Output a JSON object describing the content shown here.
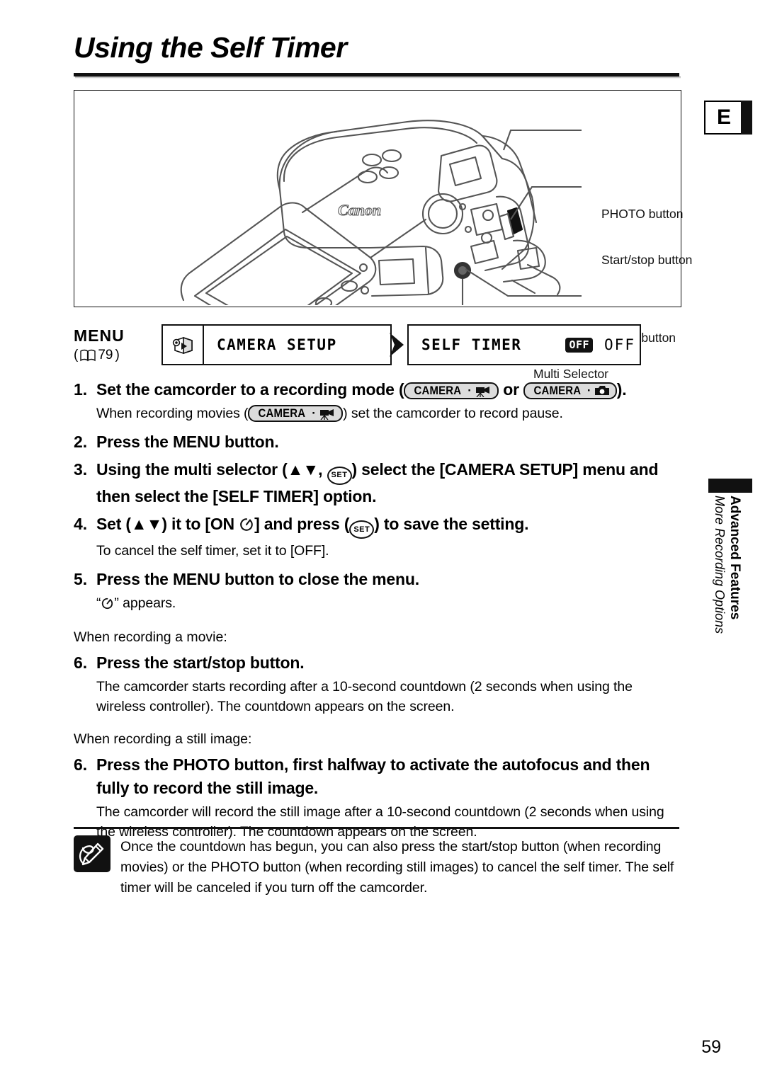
{
  "page": {
    "title": "Using the Self Timer",
    "edition_tab": "E",
    "page_number": "59"
  },
  "figure": {
    "callouts": [
      {
        "id": "photo-button",
        "label": "PHOTO button"
      },
      {
        "id": "start-stop-button",
        "label": "Start/stop button"
      },
      {
        "id": "menu-button",
        "label": "MENU button"
      },
      {
        "id": "multi-selector",
        "label": "Multi Selector"
      }
    ],
    "device_brand": "Canon"
  },
  "menu_strip": {
    "label": "MENU",
    "page_ref_open": "(",
    "page_ref": "79",
    "page_ref_close": ")",
    "book_icon": "book-icon",
    "first_box": {
      "icon": "camcorder-icon",
      "text": "CAMERA SETUP"
    },
    "arrow_icon": "arrow-right-icon",
    "second_box": {
      "text": "SELF TIMER",
      "badge": "OFF",
      "value": "OFF"
    }
  },
  "steps": [
    {
      "num": "1.",
      "head_pre": "Set the camcorder to a recording mode (",
      "badge1_label": "CAMERA",
      "badge1_icon": "movie-camera-icon",
      "head_mid": " or ",
      "badge2_label": "CAMERA",
      "badge2_icon": "still-camera-icon",
      "head_post": ").",
      "sub_pre": "When recording movies (",
      "sub_badge_label": "CAMERA",
      "sub_badge_icon": "movie-camera-icon",
      "sub_post": ") set the camcorder to record pause."
    },
    {
      "num": "2.",
      "head": "Press the MENU button."
    },
    {
      "num": "3.",
      "head_pre": "Using the multi selector (",
      "updown_icon": "up-down-triangles-icon",
      "head_mid": ", ",
      "set_icon": "SET",
      "head_post": ") select the [CAMERA SETUP] menu and then select the [SELF TIMER] option."
    },
    {
      "num": "4.",
      "head_pre": "Set (",
      "updown_icon": "up-down-triangles-icon",
      "head_mid": ") it to [ON ",
      "timer_icon": "self-timer-icon",
      "head_mid2": "] and press (",
      "set_icon": "SET",
      "head_post": ") to save the setting.",
      "sub": "To cancel the self timer, set it to [OFF]."
    },
    {
      "num": "5.",
      "head": "Press the MENU button to close the menu.",
      "sub_pre": "“",
      "sub_icon": "self-timer-icon",
      "sub_post": "” appears."
    }
  ],
  "movie_section": {
    "intro": "When recording a movie:",
    "num": "6.",
    "head": "Press the start/stop button.",
    "sub": "The camcorder starts recording after a 10-second countdown (2 seconds when using the wireless controller). The countdown appears on the screen."
  },
  "still_section": {
    "intro": "When recording a still image:",
    "num": "6.",
    "head": "Press the PHOTO button, first halfway to activate the autofocus and then fully to record the still image.",
    "sub": "The camcorder will record the still image after a 10-second countdown (2 seconds when using the wireless controller). The countdown appears on the screen."
  },
  "note": {
    "icon": "note-pencil-icon",
    "text": "Once the countdown has begun, you can also press the start/stop button (when recording movies) or the PHOTO button (when recording still images) to cancel the self timer. The self timer will be canceled if you turn off the camcorder."
  },
  "side_tab": {
    "main": "Advanced Features",
    "sub": "More Recording Options"
  }
}
